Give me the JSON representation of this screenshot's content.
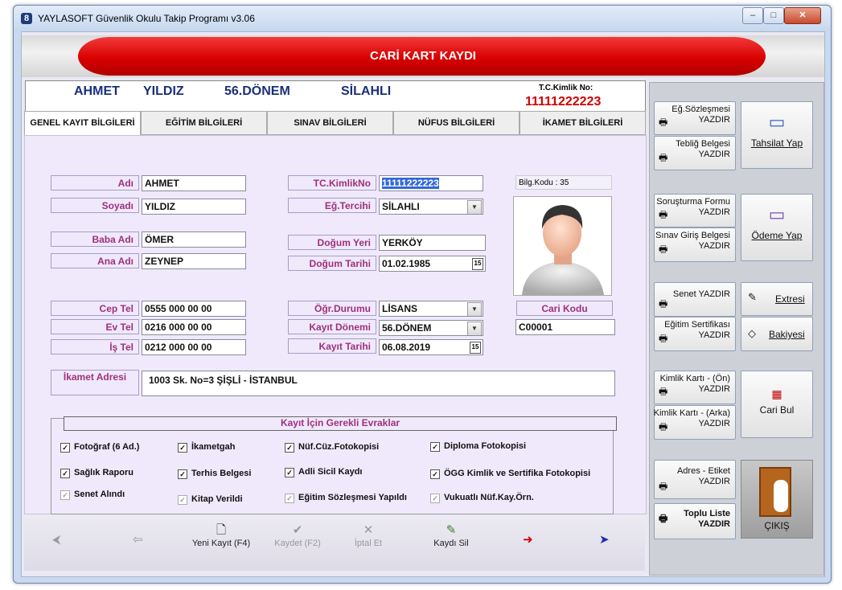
{
  "window": {
    "title": "YAYLASOFT Güvenlik Okulu Takip Programı v3.06"
  },
  "banner": {
    "title": "CARİ KART KAYDI"
  },
  "header": {
    "ad": "AHMET",
    "soyad": "YILDIZ",
    "donem": "56.DÖNEM",
    "tercih": "SİLAHLI",
    "tc_label": "T.C.Kimlik No:",
    "tc_value": "11111222223"
  },
  "tabs": [
    "GENEL KAYIT BİLGİLERİ",
    "EĞİTİM BİLGİLERİ",
    "SINAV BİLGİLERİ",
    "NÜFUS BİLGİLERİ",
    "İKAMET BİLGİLERİ"
  ],
  "form": {
    "adi_label": "Adı",
    "adi": "AHMET",
    "soyadi_label": "Soyadı",
    "soyadi": "YILDIZ",
    "baba_label": "Baba Adı",
    "baba": "ÖMER",
    "ana_label": "Ana Adı",
    "ana": "ZEYNEP",
    "cep_label": "Cep Tel",
    "cep": "0555 000 00 00",
    "ev_label": "Ev  Tel",
    "ev": "0216 000 00 00",
    "is_label": "İş  Tel",
    "is": "0212 000 00 00",
    "tc_label": "TC.KimlikNo",
    "tc": "11111222223",
    "tercih_label": "Eğ.Tercihi",
    "tercih": "SİLAHLI",
    "dogum_yeri_label": "Doğum Yeri",
    "dogum_yeri": "YERKÖY",
    "dogum_tarihi_label": "Doğum Tarihi",
    "dogum_tarihi": "01.02.1985",
    "ogr_label": "Öğr.Durumu",
    "ogr": "LİSANS",
    "kayit_donemi_label": "Kayıt Dönemi",
    "kayit_donemi": "56.DÖNEM",
    "kayit_tarihi_label": "Kayıt Tarihi",
    "kayit_tarihi": "06.08.2019",
    "bilg_kodu": "Bilg.Kodu : 35",
    "cari_kodu_label": "Cari Kodu",
    "cari_kodu": "C00001",
    "ikamet_label": "İkamet Adresi",
    "ikamet": "1003 Sk. No=3 ŞİŞLİ - İSTANBUL"
  },
  "evraklar": {
    "title": "Kayıt İçin Gerekli Evraklar",
    "items": [
      {
        "label": "Fotoğraf  (6 Ad.)",
        "checked": true
      },
      {
        "label": "İkametgah",
        "checked": true
      },
      {
        "label": "Nüf.Cüz.Fotokopisi",
        "checked": true
      },
      {
        "label": "Diploma Fotokopisi",
        "checked": true
      },
      {
        "label": "Sağlık Raporu",
        "checked": true
      },
      {
        "label": "Terhis Belgesi",
        "checked": true
      },
      {
        "label": "Adli Sicil Kaydı",
        "checked": true
      },
      {
        "label": "ÖGG Kimlik ve Sertifika Fotokopisi",
        "checked": true
      },
      {
        "label": "Senet Alındı",
        "checked": true
      },
      {
        "label": "Kitap Verildi",
        "checked": true
      },
      {
        "label": "Eğitim Sözleşmesi Yapıldı",
        "checked": true
      },
      {
        "label": "Vukuatlı Nüf.Kay.Örn.",
        "checked": true
      }
    ]
  },
  "nav": {
    "new": "Yeni Kayıt (F4)",
    "save": "Kaydet (F2)",
    "cancel": "İptal Et",
    "delete": "Kaydı Sil"
  },
  "side": {
    "sozlesme": "Eğ.Sözleşmesi\nYAZDIR",
    "teblig": "Tebliğ Belgesi\nYAZDIR",
    "tahsilat": "Tahsilat Yap",
    "sorusturma": "Soruşturma Formu\nYAZDIR",
    "sinav_giris": "Sınav Giriş Belgesi\nYAZDIR",
    "odeme": "Ödeme Yap",
    "senet": "Senet YAZDIR",
    "egitim_sert": "Eğitim Sertifikası\nYAZDIR",
    "extresi": "Extresi",
    "bakiyesi": "Bakiyesi",
    "kimlik_on": "Kimlik Kartı - (Ön)\nYAZDIR",
    "kimlik_arka": "Kimlik Kartı - (Arka)\nYAZDIR",
    "cari_bul": "Cari Bul",
    "adres_etiket": "Adres - Etiket\nYAZDIR",
    "toplu_liste": "Toplu Liste\nYAZDIR",
    "cikis": "ÇIKIŞ"
  }
}
